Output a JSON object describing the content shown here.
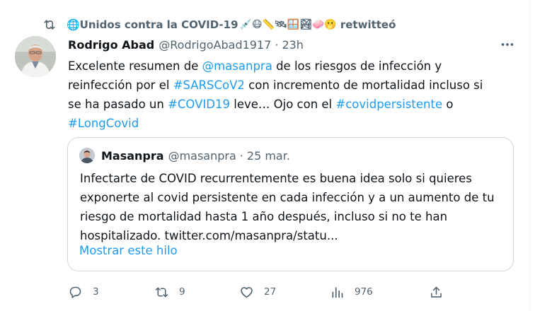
{
  "retweet": {
    "user": "🌐Unidos contra la COVID-19",
    "emojis": "💉😷📏🛰🪟🏞🧼🫢",
    "suffix": "retwitteó"
  },
  "tweet": {
    "author_name": "Rodrigo Abad",
    "author_handle": "@RodrigoAbad1917",
    "separator": "·",
    "time": "23h",
    "text": {
      "l1_a": "Excelente resumen de ",
      "l1_mention": "@masanpra",
      "l1_b": " de los riesgos de infección y",
      "l2_a": "reinfección por el ",
      "l2_tag": "#SARSCoV2",
      "l2_b": " con incremento de mortalidad incluso si",
      "l3_a": "se ha pasado un ",
      "l3_tag": "#COVID19",
      "l3_b": " leve… Ojo con el ",
      "l3_tag2": "#covidpersistente",
      "l3_c": " o",
      "l4_tag": "#LongCovid"
    }
  },
  "quote": {
    "author_name": "Masanpra",
    "author_handle": "@masanpra",
    "separator": "·",
    "date": "25 mar.",
    "lines": [
      "Infectarte de COVID recurrentemente es buena idea solo si quieres",
      "exponerte al covid persistente en cada infección y a un aumento de tu",
      "riesgo de mortalidad hasta 1 año después, incluso si no te han",
      "hospitalizado. twitter.com/masanpra/statu..."
    ],
    "show_thread": "Mostrar este hilo"
  },
  "actions": {
    "replies": "3",
    "retweets": "9",
    "likes": "27",
    "views": "976"
  },
  "colors": {
    "accent": "#1d9bf0",
    "muted": "#536471",
    "text": "#0f1419",
    "border": "#cfd9de"
  },
  "icons": [
    "retweet-icon",
    "more-icon",
    "reply-icon",
    "like-icon",
    "views-icon",
    "share-icon"
  ]
}
